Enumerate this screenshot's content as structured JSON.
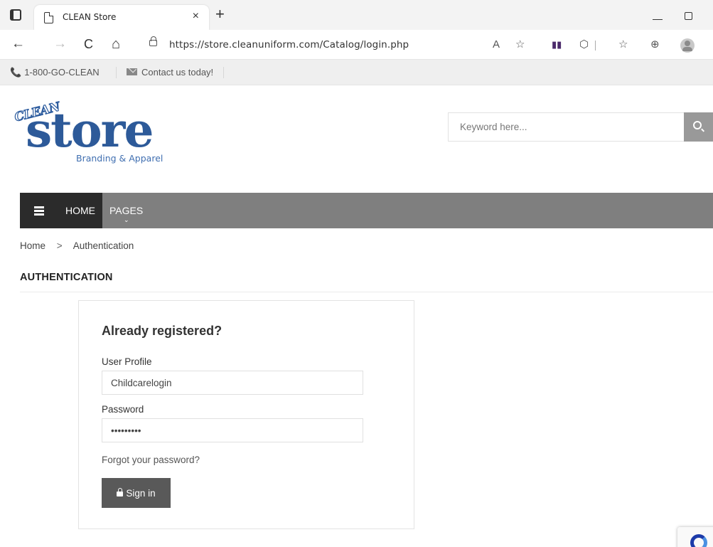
{
  "browser": {
    "tab_title": "CLEAN Store",
    "tab_close": "×",
    "new_tab": "+",
    "url": "https://store.cleanuniform.com/Catalog/login.php",
    "back": "←",
    "forward": "→",
    "refresh": "C",
    "home": "⌂",
    "read_aloud": "A",
    "favorites_add": "☆",
    "extensions": "⬡",
    "favorites": "☆",
    "collections": "⊕"
  },
  "topbar": {
    "phone": "1-800-GO-CLEAN",
    "contact": "Contact us today!"
  },
  "logo": {
    "clean": "CLEAN",
    "store": "store",
    "tagline": "Branding & Apparel"
  },
  "search": {
    "placeholder": "Keyword here..."
  },
  "nav": {
    "home": "HOME",
    "pages": "PAGES",
    "pages_caret": "⌄"
  },
  "breadcrumb": {
    "home": "Home",
    "separator": ">",
    "current": "Authentication"
  },
  "page_title": "AUTHENTICATION",
  "login": {
    "heading": "Already registered?",
    "user_label": "User Profile",
    "user_value": "Childcarelogin",
    "password_label": "Password",
    "password_value": "•••••••••",
    "forgot": "Forgot your password?",
    "signin": "Sign in"
  },
  "colors": {
    "nav_bg": "#7f7f7f",
    "nav_active": "#2b2b2b",
    "brand_blue": "#2d5a99",
    "signin_bg": "#595959",
    "search_btn": "#999999"
  }
}
